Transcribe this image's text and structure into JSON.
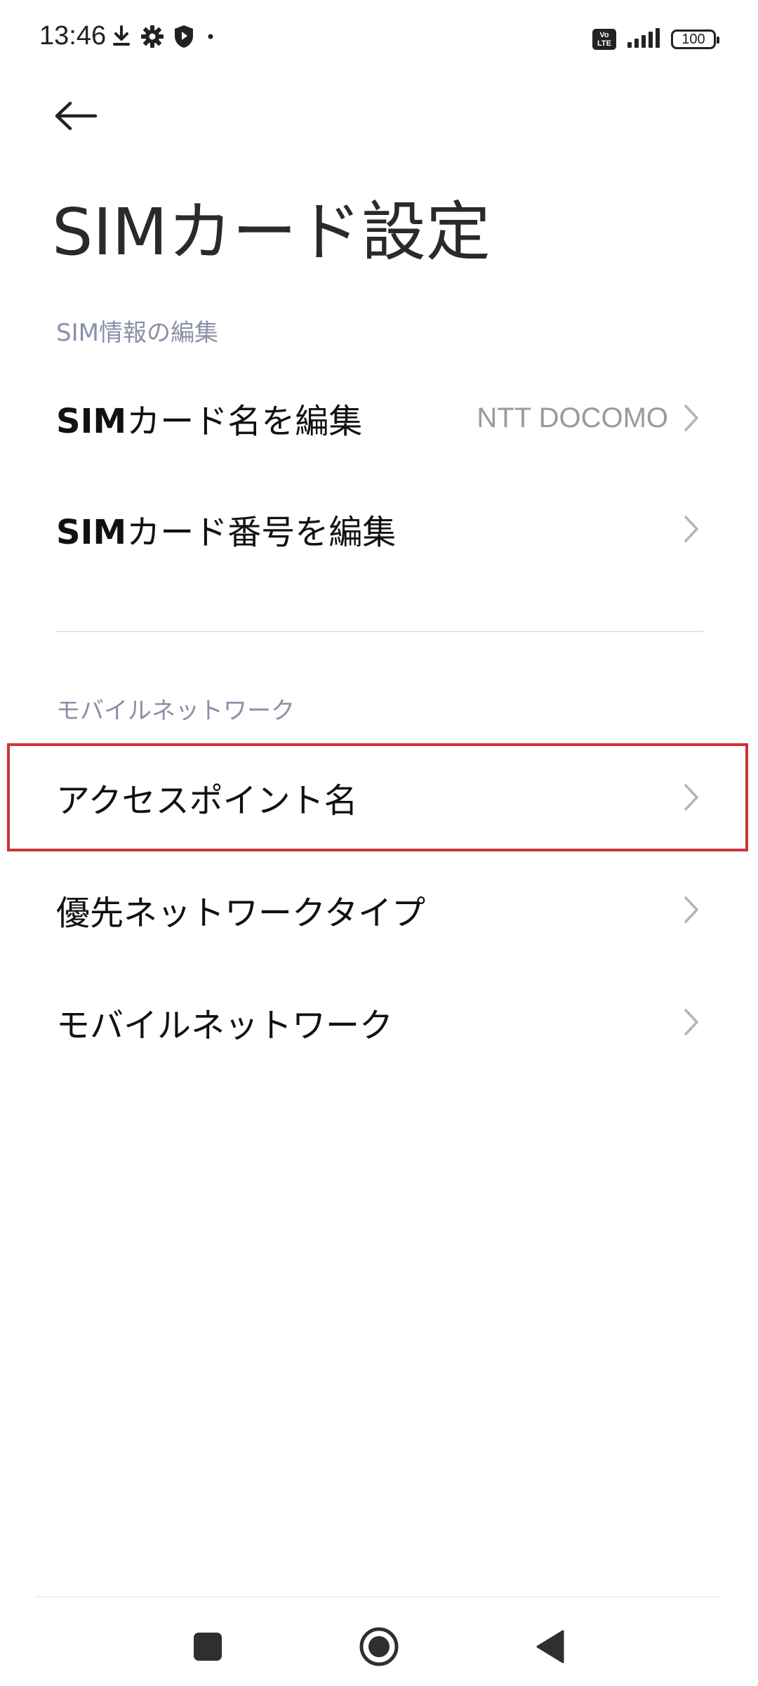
{
  "status_bar": {
    "time": "13:46",
    "battery": "100",
    "volte_top": "Vo",
    "volte_bottom": "LTE",
    "icons_left": [
      "download-icon",
      "gear-icon",
      "shield-icon",
      "dot-icon"
    ],
    "icons_right": [
      "volte-icon",
      "signal-icon",
      "battery-icon"
    ]
  },
  "header": {
    "back_icon": "arrow-left-icon",
    "title": "SIMカード設定"
  },
  "sections": [
    {
      "header": "SIM情報の編集",
      "items": [
        {
          "label_bold": "SIM",
          "label_rest": "カード名を編集",
          "value": "NTT DOCOMO"
        },
        {
          "label_bold": "SIM",
          "label_rest": "カード番号を編集",
          "value": ""
        }
      ]
    },
    {
      "header": "モバイルネットワーク",
      "items": [
        {
          "label": "アクセスポイント名",
          "highlighted": true
        },
        {
          "label": "優先ネットワークタイプ"
        },
        {
          "label": "モバイルネットワーク"
        }
      ]
    }
  ],
  "highlight_color": "#d0323a",
  "nav_bar": {
    "icons": [
      "square-icon",
      "circle-icon",
      "triangle-back-icon"
    ]
  }
}
